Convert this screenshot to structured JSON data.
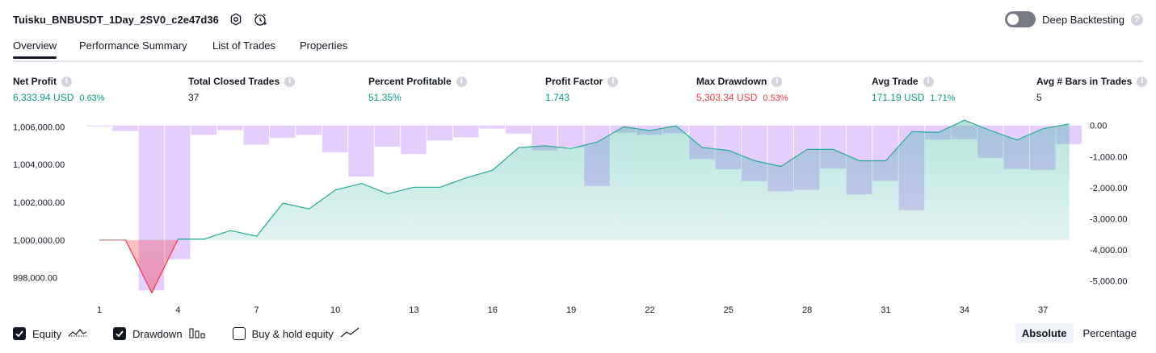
{
  "header": {
    "title": "Tuisku_BNBUSDT_1Day_2SV0_c2e47d36",
    "deep_label": "Deep Backtesting",
    "help": "?"
  },
  "tabs": [
    {
      "label": "Overview",
      "active": true
    },
    {
      "label": "Performance Summary",
      "active": false
    },
    {
      "label": "List of Trades",
      "active": false
    },
    {
      "label": "Properties",
      "active": false
    }
  ],
  "info_glyph": "i",
  "metrics": [
    {
      "label": "Net Profit",
      "value": "6,333.94 USD",
      "pct": "0.63%",
      "tone": "green"
    },
    {
      "label": "Total Closed Trades",
      "value": "37",
      "pct": "",
      "tone": "dark"
    },
    {
      "label": "Percent Profitable",
      "value": "51.35%",
      "pct": "",
      "tone": "green"
    },
    {
      "label": "Profit Factor",
      "value": "1.743",
      "pct": "",
      "tone": "green"
    },
    {
      "label": "Max Drawdown",
      "value": "5,303.34 USD",
      "pct": "0.53%",
      "tone": "red"
    },
    {
      "label": "Avg Trade",
      "value": "171.19 USD",
      "pct": "1.71%",
      "tone": "green"
    },
    {
      "label": "Avg # Bars in Trades",
      "value": "5",
      "pct": "",
      "tone": "dark"
    }
  ],
  "chart_data": {
    "type": "area",
    "grid": false,
    "x_ticks": [
      "1",
      "4",
      "7",
      "10",
      "13",
      "16",
      "19",
      "22",
      "25",
      "28",
      "31",
      "34",
      "37"
    ],
    "y_left_ticks": [
      "998,000.00",
      "1,000,000.00",
      "1,002,000.00",
      "1,004,000.00",
      "1,006,000.00"
    ],
    "y_right_ticks": [
      "0.00",
      "-1,000.00",
      "-2,000.00",
      "-3,000.00",
      "-4,000.00",
      "-5,000.00"
    ],
    "y_left_range": [
      997000,
      1006400
    ],
    "y_right_range": [
      -5500,
      200
    ],
    "baseline": 1000000,
    "equity": {
      "x": [
        1,
        2,
        3,
        4,
        5,
        6,
        7,
        8,
        9,
        10,
        11,
        12,
        13,
        14,
        15,
        16,
        17,
        18,
        19,
        20,
        21,
        22,
        23,
        24,
        25,
        26,
        27,
        28,
        29,
        30,
        31,
        32,
        33,
        34,
        35,
        36,
        37,
        38
      ],
      "values": [
        1000000,
        1000000,
        997200,
        1000050,
        1000050,
        1000500,
        1000200,
        1001950,
        1001650,
        1002650,
        1003000,
        1002450,
        1002800,
        1002800,
        1003300,
        1003700,
        1004900,
        1005000,
        1004850,
        1005200,
        1006000,
        1005800,
        1006050,
        1004900,
        1004750,
        1004200,
        1003900,
        1004800,
        1004800,
        1004200,
        1004200,
        1005750,
        1005700,
        1006350,
        1005800,
        1005300,
        1005900,
        1006150
      ],
      "line_up": "#22ab94",
      "line_down": "#f23645"
    },
    "drawdown": {
      "x": [
        1,
        2,
        3,
        4,
        5,
        6,
        7,
        8,
        9,
        10,
        11,
        12,
        13,
        14,
        15,
        16,
        17,
        18,
        19,
        20,
        21,
        22,
        23,
        24,
        25,
        26,
        27,
        28,
        29,
        30,
        31,
        32,
        33,
        34,
        35,
        36,
        37,
        38
      ],
      "values": [
        0,
        -180,
        -5303,
        -4300,
        -300,
        -150,
        -620,
        -400,
        -300,
        -860,
        -1640,
        -680,
        -920,
        -480,
        -380,
        -100,
        -260,
        -800,
        -700,
        -1940,
        -230,
        -300,
        -250,
        -1080,
        -1410,
        -1790,
        -2120,
        -2070,
        -1390,
        -2220,
        -1780,
        -2720,
        -450,
        -440,
        -1040,
        -1400,
        -1430,
        -600
      ],
      "color": "#e1c5fd"
    },
    "legend": [
      {
        "name": "Equity",
        "checked": true
      },
      {
        "name": "Drawdown",
        "checked": true
      },
      {
        "name": "Buy & hold equity",
        "checked": false
      }
    ]
  },
  "modes": {
    "absolute": "Absolute",
    "percentage": "Percentage"
  }
}
